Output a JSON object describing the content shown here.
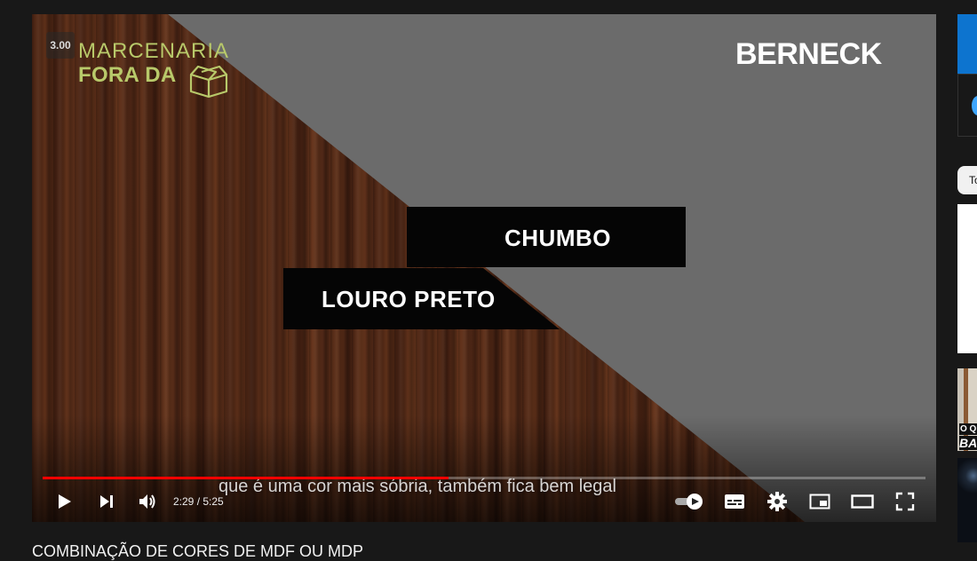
{
  "player": {
    "speed_badge": "3.00",
    "logo_line1": "MARCENARIA",
    "logo_line2": "FORA DA",
    "brand_logo": "BERNECK",
    "banner_top": "CHUMBO",
    "banner_bottom": "LOURO PRETO",
    "caption": "que é uma cor mais sóbria, também fica bem legal",
    "time": "2:29 / 5:25",
    "progress_fraction": 0.46,
    "progress_color": "#ff0000",
    "logo_color": "#b8c96a"
  },
  "controls": {
    "icons": [
      "play-icon",
      "next-icon",
      "volume-icon",
      "autoplay-icon",
      "subtitles-icon",
      "settings-icon",
      "miniplayer-icon",
      "theater-icon",
      "fullscreen-icon"
    ]
  },
  "video": {
    "title": "COMBINAÇÃO DE CORES DE MDF OU MDP"
  },
  "sidebar": {
    "chip_all": "To",
    "thumb_1_line1": "O QU",
    "thumb_1_line2": "BA"
  }
}
